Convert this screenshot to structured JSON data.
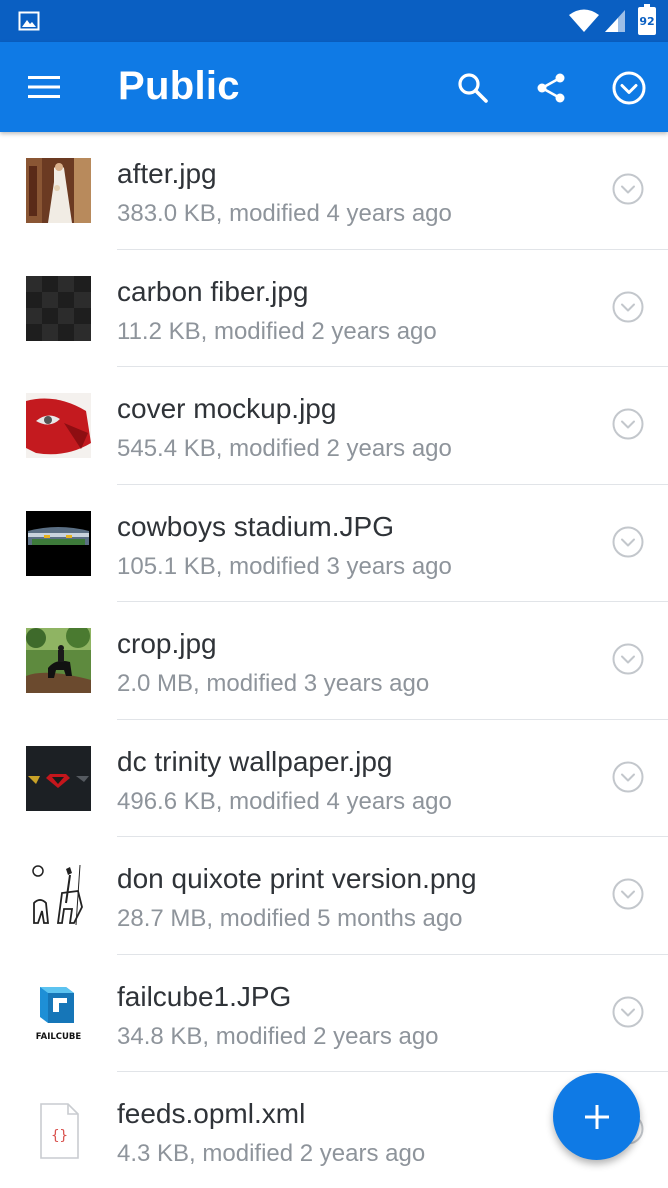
{
  "status_bar": {
    "battery_level": "92",
    "icons": [
      "image-notification-icon",
      "wifi-icon",
      "cell-signal-icon",
      "battery-icon"
    ]
  },
  "app_bar": {
    "title": "Public",
    "icons": [
      "menu-icon",
      "search-icon",
      "share-icon",
      "select-all-icon"
    ]
  },
  "colors": {
    "status_bar": "#0a5fc2",
    "app_bar": "#0f7ae5",
    "fab": "#0f7ae5",
    "file_name": "#2f3338",
    "file_meta": "#8e949b"
  },
  "files": [
    {
      "name": "after.jpg",
      "meta": "383.0 KB, modified 4 years ago",
      "thumb": "wedding-photo"
    },
    {
      "name": "carbon fiber.jpg",
      "meta": "11.2 KB, modified 2 years ago",
      "thumb": "carbon-fiber"
    },
    {
      "name": "cover mockup.jpg",
      "meta": "545.4 KB, modified 2 years ago",
      "thumb": "red-mask"
    },
    {
      "name": "cowboys stadium.JPG",
      "meta": "105.1 KB, modified 3 years ago",
      "thumb": "stadium"
    },
    {
      "name": "crop.jpg",
      "meta": "2.0 MB, modified 3 years ago",
      "thumb": "horse-rider"
    },
    {
      "name": "dc trinity wallpaper.jpg",
      "meta": "496.6 KB, modified 4 years ago",
      "thumb": "dc-logos"
    },
    {
      "name": "don quixote print version.png",
      "meta": "28.7 MB, modified 5 months ago",
      "thumb": "don-quixote-sketch"
    },
    {
      "name": "failcube1.JPG",
      "meta": "34.8 KB, modified 2 years ago",
      "thumb": "failcube-logo",
      "thumb_text": "FAILCUBE"
    },
    {
      "name": "feeds.opml.xml",
      "meta": "4.3 KB, modified 2 years ago",
      "thumb": "code-file-icon",
      "thumb_text": "{}"
    }
  ],
  "fab": {
    "label": "+"
  }
}
